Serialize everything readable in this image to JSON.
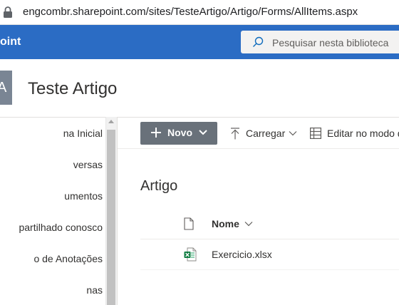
{
  "browser": {
    "url": "engcombr.sharepoint.com/sites/TesteArtigo/Artigo/Forms/AllItems.aspx"
  },
  "suitebar": {
    "brand": "oint",
    "search_placeholder": "Pesquisar nesta biblioteca",
    "color": "#2b6cc4"
  },
  "site": {
    "logo_letter": "A",
    "title": "Teste Artigo"
  },
  "leftnav": {
    "items": [
      {
        "label": "na Inicial"
      },
      {
        "label": "versas"
      },
      {
        "label": "umentos"
      },
      {
        "label": "partilhado conosco"
      },
      {
        "label": "o de Anotações"
      },
      {
        "label": "nas"
      }
    ]
  },
  "commandbar": {
    "new_label": "Novo",
    "upload_label": "Carregar",
    "edit_label": "Editar no modo d"
  },
  "library": {
    "title": "Artigo",
    "columns": {
      "name": "Nome"
    },
    "files": [
      {
        "name": "Exercicio.xlsx",
        "icon": "excel-icon"
      }
    ]
  }
}
